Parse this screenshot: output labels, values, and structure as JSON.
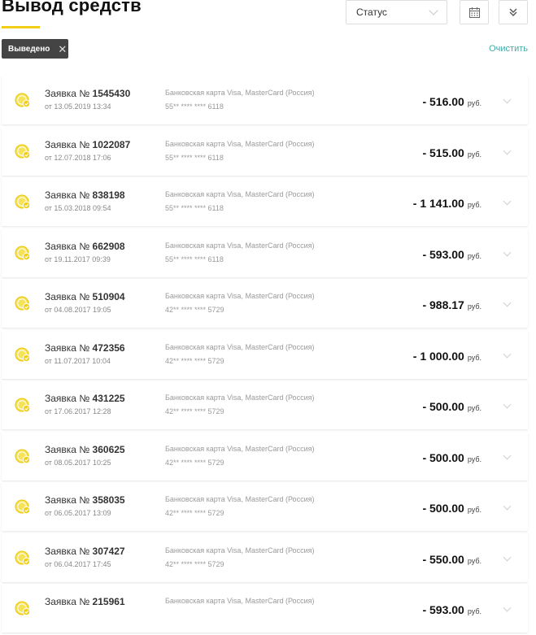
{
  "header": {
    "title": "Вывод средств"
  },
  "filters": {
    "status_label": "Статус",
    "active_chip": "Выведено",
    "clear_label": "Очистить",
    "colors": {
      "accent": "#f2cf16",
      "link": "#47a9a4",
      "chip_bg": "#444444"
    }
  },
  "icons": {
    "calendar": "calendar-icon",
    "expand": "double-chevron-down-icon",
    "status_row": "coin-check-icon"
  },
  "requests": [
    {
      "label": "Заявка №",
      "number": "1545430",
      "date": "от 13.05.2019 13:34",
      "method": "Банковская карта Visa, MasterCard (Россия)",
      "card": "55** **** **** 6118",
      "amount": "- 516.00",
      "currency": "руб."
    },
    {
      "label": "Заявка №",
      "number": "1022087",
      "date": "от 12.07.2018 17:06",
      "method": "Банковская карта Visa, MasterCard (Россия)",
      "card": "55** **** **** 6118",
      "amount": "- 515.00",
      "currency": "руб."
    },
    {
      "label": "Заявка №",
      "number": "838198",
      "date": "от 15.03.2018 09:54",
      "method": "Банковская карта Visa, MasterCard (Россия)",
      "card": "55** **** **** 6118",
      "amount": "- 1 141.00",
      "currency": "руб."
    },
    {
      "label": "Заявка №",
      "number": "662908",
      "date": "от 19.11.2017 09:39",
      "method": "Банковская карта Visa, MasterCard (Россия)",
      "card": "55** **** **** 6118",
      "amount": "- 593.00",
      "currency": "руб."
    },
    {
      "label": "Заявка №",
      "number": "510904",
      "date": "от 04.08.2017 19:05",
      "method": "Банковская карта Visa, MasterCard (Россия)",
      "card": "42** **** **** 5729",
      "amount": "- 988.17",
      "currency": "руб."
    },
    {
      "label": "Заявка №",
      "number": "472356",
      "date": "от 11.07.2017 10:04",
      "method": "Банковская карта Visa, MasterCard (Россия)",
      "card": "42** **** **** 5729",
      "amount": "- 1 000.00",
      "currency": "руб."
    },
    {
      "label": "Заявка №",
      "number": "431225",
      "date": "от 17.06.2017 12:28",
      "method": "Банковская карта Visa, MasterCard (Россия)",
      "card": "42** **** **** 5729",
      "amount": "- 500.00",
      "currency": "руб."
    },
    {
      "label": "Заявка №",
      "number": "360625",
      "date": "от 08.05.2017 10:25",
      "method": "Банковская карта Visa, MasterCard (Россия)",
      "card": "42** **** **** 5729",
      "amount": "- 500.00",
      "currency": "руб."
    },
    {
      "label": "Заявка №",
      "number": "358035",
      "date": "от 06.05.2017 13:09",
      "method": "Банковская карта Visa, MasterCard (Россия)",
      "card": "42** **** **** 5729",
      "amount": "- 500.00",
      "currency": "руб."
    },
    {
      "label": "Заявка №",
      "number": "307427",
      "date": "от 06.04.2017 17:45",
      "method": "Банковская карта Visa, MasterCard (Россия)",
      "card": "42** **** **** 5729",
      "amount": "- 550.00",
      "currency": "руб."
    },
    {
      "label": "Заявка №",
      "number": "215961",
      "date": "",
      "method": "Банковская карта Visa, MasterCard (Россия)",
      "card": "",
      "amount": "- 593.00",
      "currency": "руб."
    }
  ]
}
